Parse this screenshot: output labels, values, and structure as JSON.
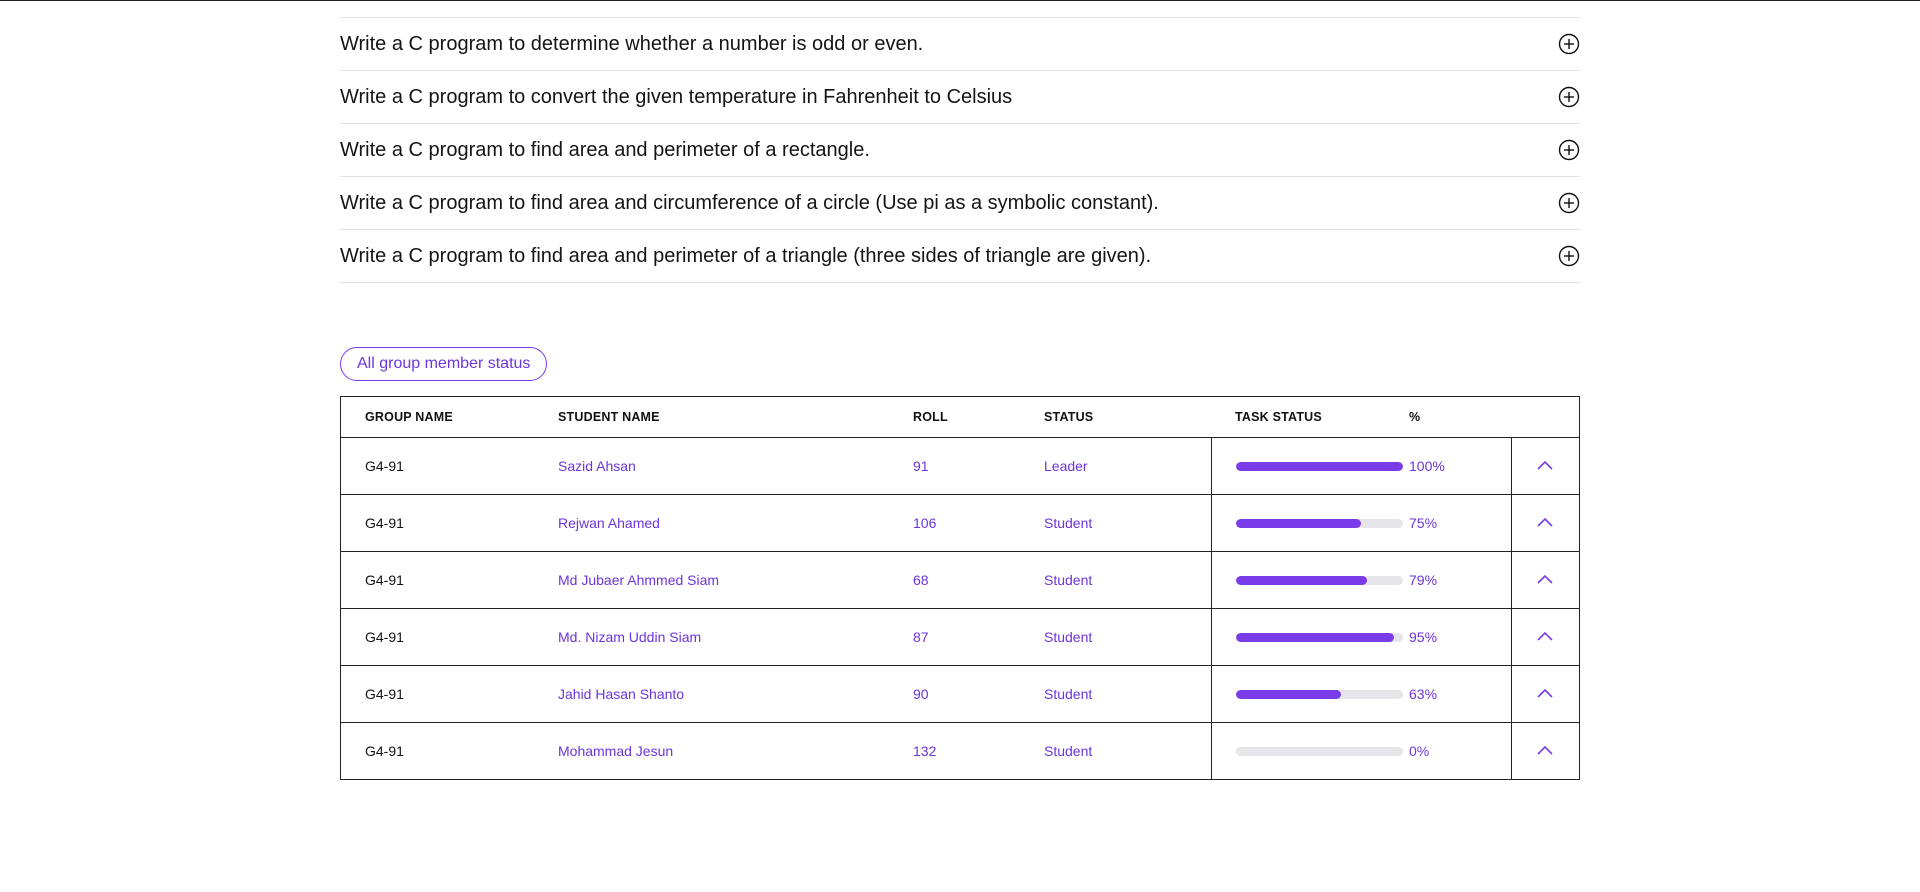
{
  "faq": {
    "items": [
      "Write a C program to determine whether a number is odd or even.",
      "Write a C program to convert the given temperature in Fahrenheit to Celsius",
      "Write a C program to find area and perimeter of a rectangle.",
      "Write a C program to find area and circumference of a circle (Use pi as a symbolic constant).",
      "Write a C program to find area and perimeter of a triangle (three sides of triangle are given)."
    ],
    "icon": "plus-circle-icon"
  },
  "status_button": {
    "label": "All group member status"
  },
  "table": {
    "headers": {
      "group": "GROUP NAME",
      "student": "STUDENT NAME",
      "roll": "ROLL",
      "status": "STATUS",
      "task": "TASK STATUS",
      "percent": "%"
    },
    "rows": [
      {
        "group": "G4-91",
        "student": "Sazid Ahsan",
        "roll": "91",
        "status": "Leader",
        "progress": 1.0,
        "percent": "100%"
      },
      {
        "group": "G4-91",
        "student": "Rejwan Ahamed",
        "roll": "106",
        "status": "Student",
        "progress": 0.75,
        "percent": "75%"
      },
      {
        "group": "G4-91",
        "student": "Md Jubaer Ahmmed Siam",
        "roll": "68",
        "status": "Student",
        "progress": 0.79,
        "percent": "79%"
      },
      {
        "group": "G4-91",
        "student": "Md. Nizam Uddin Siam",
        "roll": "87",
        "status": "Student",
        "progress": 0.95,
        "percent": "95%"
      },
      {
        "group": "G4-91",
        "student": "Jahid Hasan Shanto",
        "roll": "90",
        "status": "Student",
        "progress": 0.63,
        "percent": "63%"
      },
      {
        "group": "G4-91",
        "student": "Mohammad Jesun",
        "roll": "132",
        "status": "Student",
        "progress": 0.0,
        "percent": "0%"
      }
    ],
    "row_toggle_icon": "chevron-up-icon"
  },
  "colors": {
    "accent": "#7a3be8",
    "bar_track": "#e6e6ea",
    "text": "#141414"
  }
}
